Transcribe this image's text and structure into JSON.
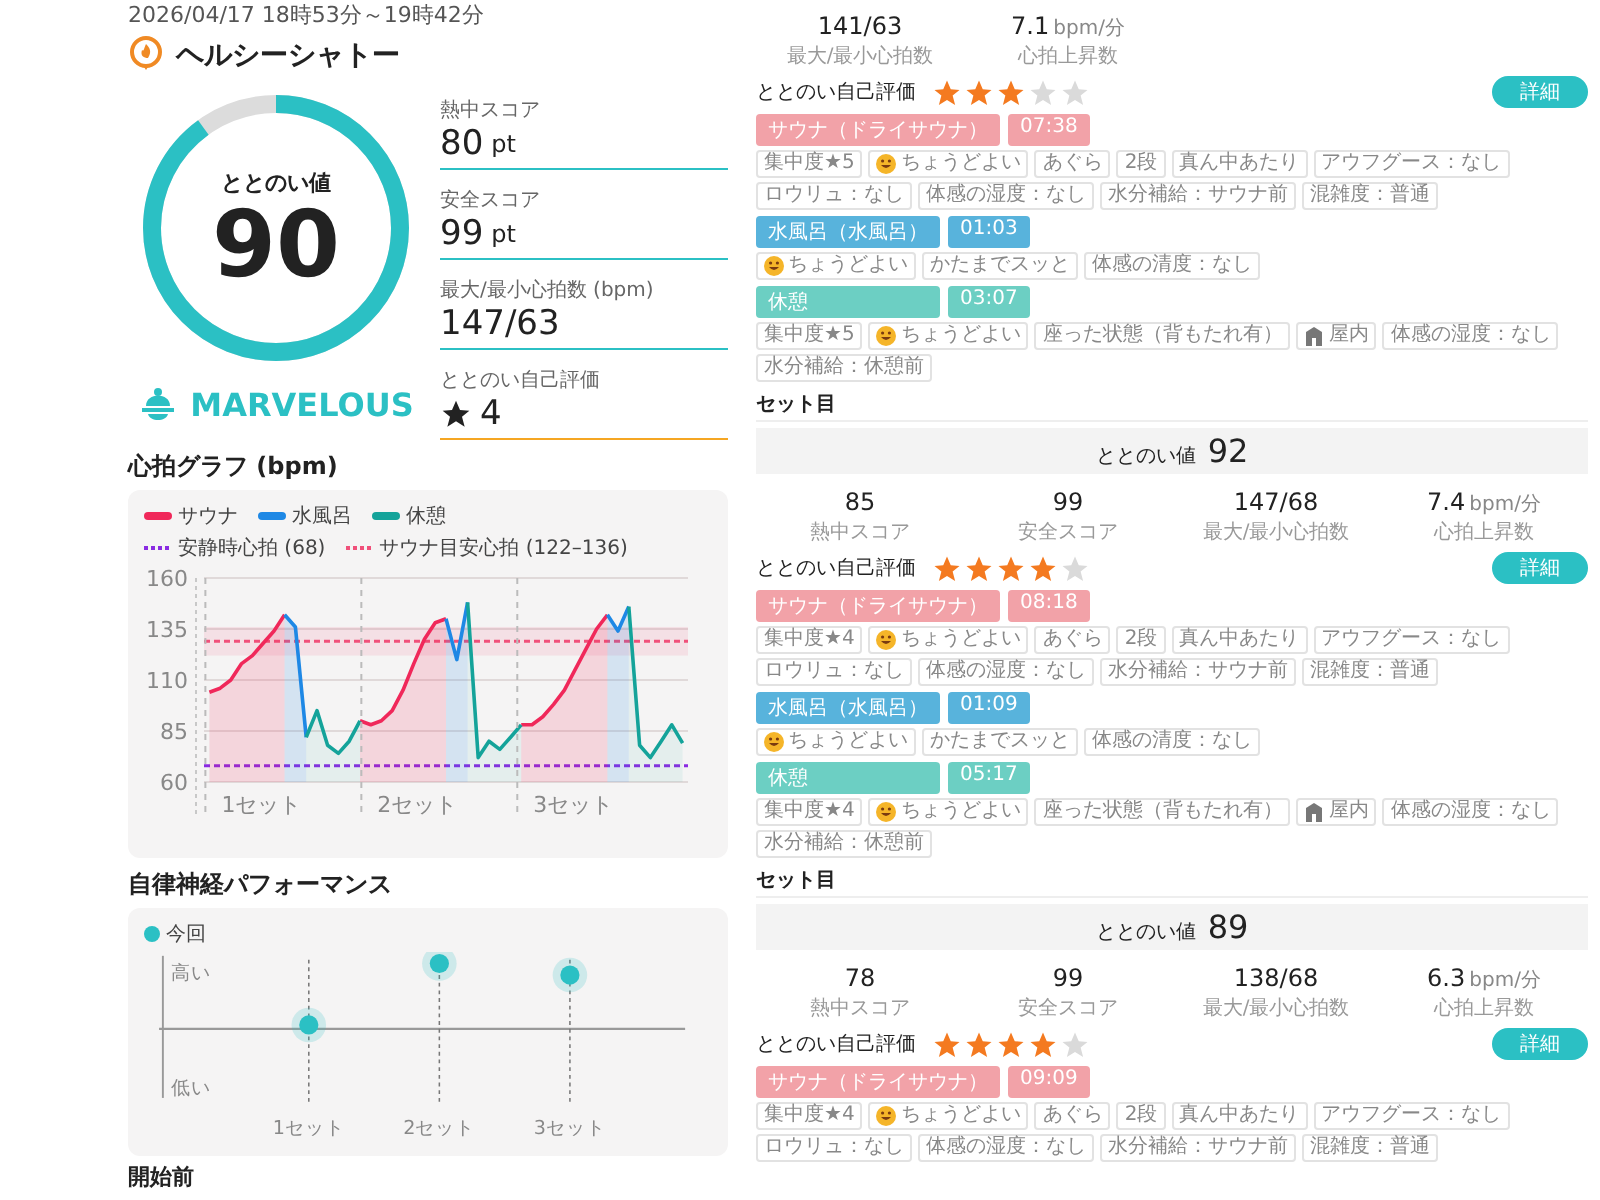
{
  "header": {
    "datetime": "2026/04/17 18時53分～19時42分",
    "facility": "ヘルシーシャトー"
  },
  "summary": {
    "label": "ととのい値",
    "value": "90",
    "level": 0.9,
    "grade": "MARVELOUS"
  },
  "stats": [
    {
      "kind": "score",
      "label": "熱中スコア",
      "value": "80",
      "unit": "pt"
    },
    {
      "kind": "score",
      "label": "安全スコア",
      "value": "99",
      "unit": "pt"
    },
    {
      "kind": "plain",
      "label": "最大/最小心拍数 (bpm)",
      "value": "147/63"
    },
    {
      "kind": "rating",
      "label": "ととのい自己評価",
      "value": "4"
    }
  ],
  "heart_chart": {
    "title": "心拍グラフ (bpm)",
    "sets": [
      "1セット",
      "2セット",
      "3セット"
    ],
    "chart_data": {
      "type": "area",
      "categories": [
        null,
        null,
        null,
        null,
        null,
        null,
        null,
        null,
        null,
        null,
        null,
        null,
        null,
        null,
        null,
        null,
        null,
        null,
        null,
        null,
        null,
        null,
        null,
        null,
        null,
        null,
        null,
        null,
        null,
        null,
        null,
        null,
        null,
        null,
        null,
        null,
        null,
        null,
        null,
        null,
        null,
        null,
        null,
        null,
        null
      ],
      "ylim": [
        60,
        160
      ],
      "yticks": [
        60,
        85,
        110,
        135,
        160
      ],
      "grid": true,
      "ref_lines": [
        {
          "axis": "y",
          "value": 68,
          "label": "安静時心拍 (68)",
          "color": "#8a2be2"
        },
        {
          "axis": "y",
          "value": 129,
          "color": "#f0507a"
        }
      ],
      "bands": [
        {
          "axis": "y",
          "from": 122,
          "to": 136,
          "label": "サウナ目安心拍 (122–136)",
          "color": "#f0507a"
        }
      ],
      "series": [
        {
          "name": "サウナ",
          "color": "#f0285a",
          "values": [
            104,
            106,
            110,
            118,
            122,
            128,
            134,
            142,
            null,
            null,
            null,
            null,
            null,
            null,
            90,
            88,
            90,
            95,
            105,
            118,
            130,
            138,
            140,
            null,
            null,
            null,
            null,
            null,
            null,
            88,
            88,
            92,
            98,
            105,
            115,
            125,
            135,
            142,
            null,
            null,
            null,
            null,
            null,
            null,
            null
          ]
        },
        {
          "name": "水風呂",
          "color": "#1e88e5",
          "values": [
            null,
            null,
            null,
            null,
            null,
            null,
            null,
            142,
            136,
            82,
            null,
            null,
            null,
            null,
            null,
            null,
            null,
            null,
            null,
            null,
            null,
            null,
            140,
            120,
            148,
            null,
            null,
            null,
            null,
            null,
            null,
            null,
            null,
            null,
            null,
            null,
            null,
            142,
            134,
            146,
            null,
            null,
            null,
            null,
            null
          ]
        },
        {
          "name": "休憩",
          "color": "#14a39a",
          "values": [
            null,
            null,
            null,
            null,
            null,
            null,
            null,
            null,
            null,
            82,
            95,
            78,
            74,
            80,
            90,
            null,
            null,
            null,
            null,
            null,
            null,
            null,
            null,
            null,
            148,
            72,
            80,
            76,
            82,
            88,
            null,
            null,
            null,
            null,
            null,
            null,
            null,
            null,
            null,
            146,
            78,
            72,
            80,
            88,
            79
          ]
        }
      ]
    }
  },
  "autonomic": {
    "title": "自律神経パフォーマンス",
    "legend": "今回",
    "y_high": "高い",
    "y_low": "低い",
    "sets": [
      "1セット",
      "2セット",
      "3セット"
    ]
  },
  "next_section": "開始前",
  "sets": [
    {
      "stats": [
        {
          "value": "141/63",
          "label": "最大/最小心拍数"
        },
        {
          "value": "7.1",
          "unit": "bpm/分",
          "label": "心拍上昇数"
        }
      ],
      "rating": {
        "label": "ととのい自己評価",
        "stars": 3,
        "button": "詳細"
      },
      "steps": [
        {
          "kind": "sauna",
          "name": "サウナ（ドライサウナ）",
          "time": "07:38",
          "tags": [
            {
              "kind": "text",
              "text": "集中度★5"
            },
            {
              "kind": "mood",
              "text": "ちょうどよい"
            },
            {
              "kind": "text",
              "text": "あぐら"
            },
            {
              "kind": "text",
              "text": "2段"
            },
            {
              "kind": "text",
              "text": "真ん中あたり"
            },
            {
              "kind": "text",
              "text": "アウフグース：なし"
            },
            {
              "kind": "text",
              "text": "ロウリュ：なし"
            },
            {
              "kind": "text",
              "text": "体感の湿度：なし"
            },
            {
              "kind": "text",
              "text": "水分補給：サウナ前"
            },
            {
              "kind": "text",
              "text": "混雑度：普通"
            }
          ]
        },
        {
          "kind": "water",
          "name": "水風呂（水風呂）",
          "time": "01:03",
          "tags": [
            {
              "kind": "mood",
              "text": "ちょうどよい"
            },
            {
              "kind": "text",
              "text": "かたまでスッと"
            },
            {
              "kind": "text",
              "text": "体感の清度：なし"
            }
          ]
        },
        {
          "kind": "rest",
          "name": "休憩",
          "time": "03:07",
          "tags": [
            {
              "kind": "text",
              "text": "集中度★5"
            },
            {
              "kind": "mood",
              "text": "ちょうどよい"
            },
            {
              "kind": "text",
              "text": "座った状態（背もたれ有）"
            },
            {
              "kind": "place",
              "text": "屋内"
            },
            {
              "kind": "text",
              "text": "体感の湿度：なし"
            },
            {
              "kind": "text",
              "text": "水分補給：休憩前"
            }
          ]
        }
      ]
    },
    {
      "header": "セット目",
      "score": {
        "label": "ととのい値",
        "value": "92"
      },
      "stats": [
        {
          "value": "85",
          "label": "熱中スコア"
        },
        {
          "value": "99",
          "label": "安全スコア"
        },
        {
          "value": "147/68",
          "label": "最大/最小心拍数"
        },
        {
          "value": "7.4",
          "unit": "bpm/分",
          "label": "心拍上昇数"
        }
      ],
      "rating": {
        "label": "ととのい自己評価",
        "stars": 4,
        "button": "詳細"
      },
      "steps": [
        {
          "kind": "sauna",
          "name": "サウナ（ドライサウナ）",
          "time": "08:18",
          "tags": [
            {
              "kind": "text",
              "text": "集中度★4"
            },
            {
              "kind": "mood",
              "text": "ちょうどよい"
            },
            {
              "kind": "text",
              "text": "あぐら"
            },
            {
              "kind": "text",
              "text": "2段"
            },
            {
              "kind": "text",
              "text": "真ん中あたり"
            },
            {
              "kind": "text",
              "text": "アウフグース：なし"
            },
            {
              "kind": "text",
              "text": "ロウリュ：なし"
            },
            {
              "kind": "text",
              "text": "体感の湿度：なし"
            },
            {
              "kind": "text",
              "text": "水分補給：サウナ前"
            },
            {
              "kind": "text",
              "text": "混雑度：普通"
            }
          ]
        },
        {
          "kind": "water",
          "name": "水風呂（水風呂）",
          "time": "01:09",
          "tags": [
            {
              "kind": "mood",
              "text": "ちょうどよい"
            },
            {
              "kind": "text",
              "text": "かたまでスッと"
            },
            {
              "kind": "text",
              "text": "体感の清度：なし"
            }
          ]
        },
        {
          "kind": "rest",
          "name": "休憩",
          "time": "05:17",
          "tags": [
            {
              "kind": "text",
              "text": "集中度★4"
            },
            {
              "kind": "mood",
              "text": "ちょうどよい"
            },
            {
              "kind": "text",
              "text": "座った状態（背もたれ有）"
            },
            {
              "kind": "place",
              "text": "屋内"
            },
            {
              "kind": "text",
              "text": "体感の湿度：なし"
            },
            {
              "kind": "text",
              "text": "水分補給：休憩前"
            }
          ]
        }
      ]
    },
    {
      "header": "セット目",
      "score": {
        "label": "ととのい値",
        "value": "89"
      },
      "stats": [
        {
          "value": "78",
          "label": "熱中スコア"
        },
        {
          "value": "99",
          "label": "安全スコア"
        },
        {
          "value": "138/68",
          "label": "最大/最小心拍数"
        },
        {
          "value": "6.3",
          "unit": "bpm/分",
          "label": "心拍上昇数"
        }
      ],
      "rating": {
        "label": "ととのい自己評価",
        "stars": 4,
        "button": "詳細"
      },
      "steps": [
        {
          "kind": "sauna",
          "name": "サウナ（ドライサウナ）",
          "time": "09:09",
          "tags": [
            {
              "kind": "text",
              "text": "集中度★4"
            },
            {
              "kind": "mood",
              "text": "ちょうどよい"
            },
            {
              "kind": "text",
              "text": "あぐら"
            },
            {
              "kind": "text",
              "text": "2段"
            },
            {
              "kind": "text",
              "text": "真ん中あたり"
            },
            {
              "kind": "text",
              "text": "アウフグース：なし"
            },
            {
              "kind": "text",
              "text": "ロウリュ：なし"
            },
            {
              "kind": "text",
              "text": "体感の湿度：なし"
            },
            {
              "kind": "text",
              "text": "水分補給：サウナ前"
            },
            {
              "kind": "text",
              "text": "混雑度：普通"
            }
          ]
        }
      ]
    }
  ]
}
